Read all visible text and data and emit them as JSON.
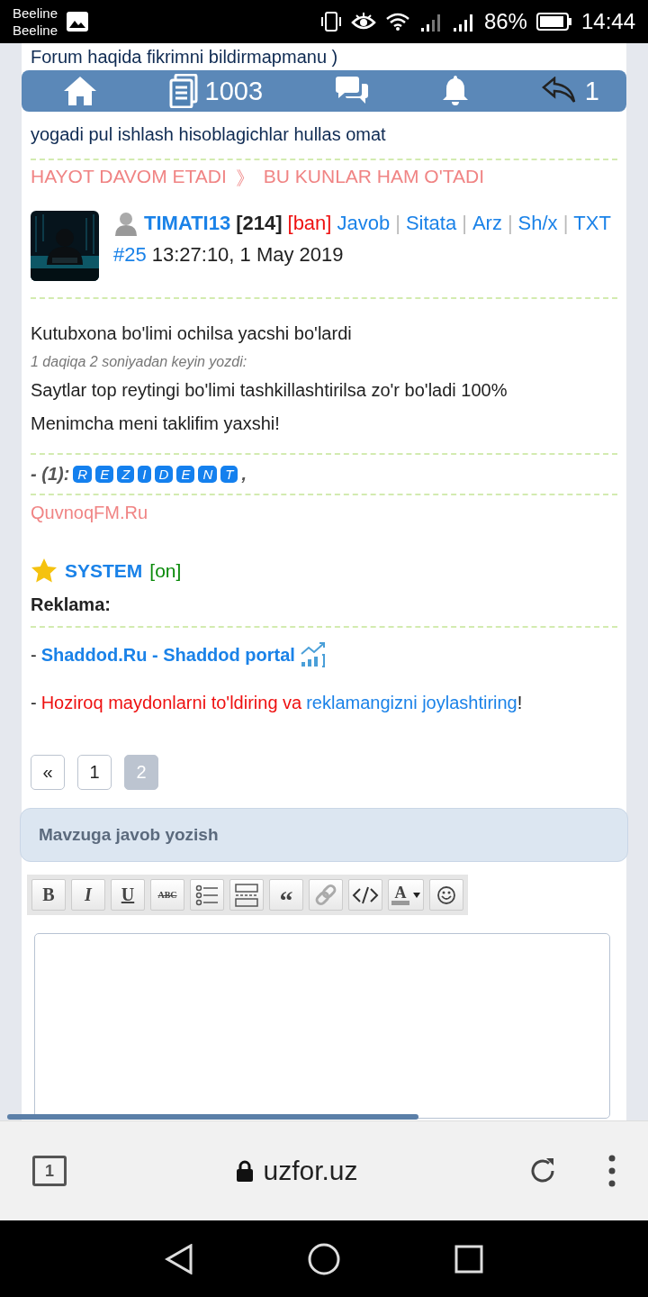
{
  "status_bar": {
    "carriers": [
      "Beeline",
      "Beeline"
    ],
    "battery": "86%",
    "time": "14:44"
  },
  "background_text": [
    "Forum haqida fikrimni bildirmapmanu )",
    "yogadi pul ishlash hisoblagichlar hullas omat"
  ],
  "top_nav": [
    {
      "kind": "home"
    },
    {
      "kind": "document",
      "count": "1003"
    },
    {
      "kind": "chat"
    },
    {
      "kind": "bell"
    },
    {
      "kind": "reply",
      "count": "1"
    }
  ],
  "breadcrumb": {
    "parent": "HAYOT DAVOM ETADI",
    "separator": "》",
    "current": "BU KUNLAR HAM O'TADI"
  },
  "post": {
    "author": "TIMATI13",
    "rating": "[214]",
    "ban": "[ban]",
    "actions": [
      "Javob",
      "Sitata",
      "Arz",
      "Sh/x",
      "TXT"
    ],
    "separator": "|",
    "number": "#25",
    "time": "13:27:10, 1 May 2019",
    "paragraphs": [
      {
        "kind": "text",
        "text": "Kutubxona bo'limi ochilsa yacshi bo'lardi"
      },
      {
        "kind": "note",
        "text": "1 daqiqa 2 soniyadan keyin yozdi:"
      },
      {
        "kind": "text",
        "text": "Saytlar top reytingi bo'limi tashkillashtirilsa zo'r bo'ladi 100%"
      },
      {
        "kind": "text",
        "text": "Menimcha meni taklifim yaxshi!"
      }
    ],
    "likes": {
      "label": "- (1):",
      "badges": [
        "R",
        "E",
        "Z",
        "I",
        "D",
        "E",
        "N",
        "T"
      ],
      "trailing": ","
    },
    "signature": "QuvnoqFM.Ru"
  },
  "system": {
    "name": "SYSTEM",
    "status": "[on]",
    "online": true
  },
  "ads": {
    "title": "Reklama:",
    "items": [
      {
        "kind": "portal",
        "dash": "-",
        "link": "Shaddod.Ru - Shaddod portal"
      },
      {
        "kind": "cta",
        "dash": "-",
        "lead": "Hoziroq maydonlarni to'ldiring va",
        "link": "reklamangizni joylashtiring",
        "end": "!"
      }
    ]
  },
  "pagination": [
    {
      "label": "«",
      "selected": false
    },
    {
      "label": "1",
      "selected": false
    },
    {
      "label": "2",
      "selected": true
    }
  ],
  "reply": {
    "title": "Mavzuga javob yozish",
    "toolbar": [
      {
        "kind": "bold",
        "label": "B"
      },
      {
        "kind": "italic",
        "label": "I"
      },
      {
        "kind": "underline",
        "label": "U"
      },
      {
        "kind": "strike",
        "label": "ABC"
      },
      {
        "kind": "list"
      },
      {
        "kind": "hr"
      },
      {
        "kind": "quote",
        "label": "“"
      },
      {
        "kind": "link"
      },
      {
        "kind": "code"
      },
      {
        "kind": "color",
        "label": "A"
      },
      {
        "kind": "smile"
      }
    ]
  },
  "browser": {
    "tabs": "1",
    "url": "uzfor.uz"
  }
}
